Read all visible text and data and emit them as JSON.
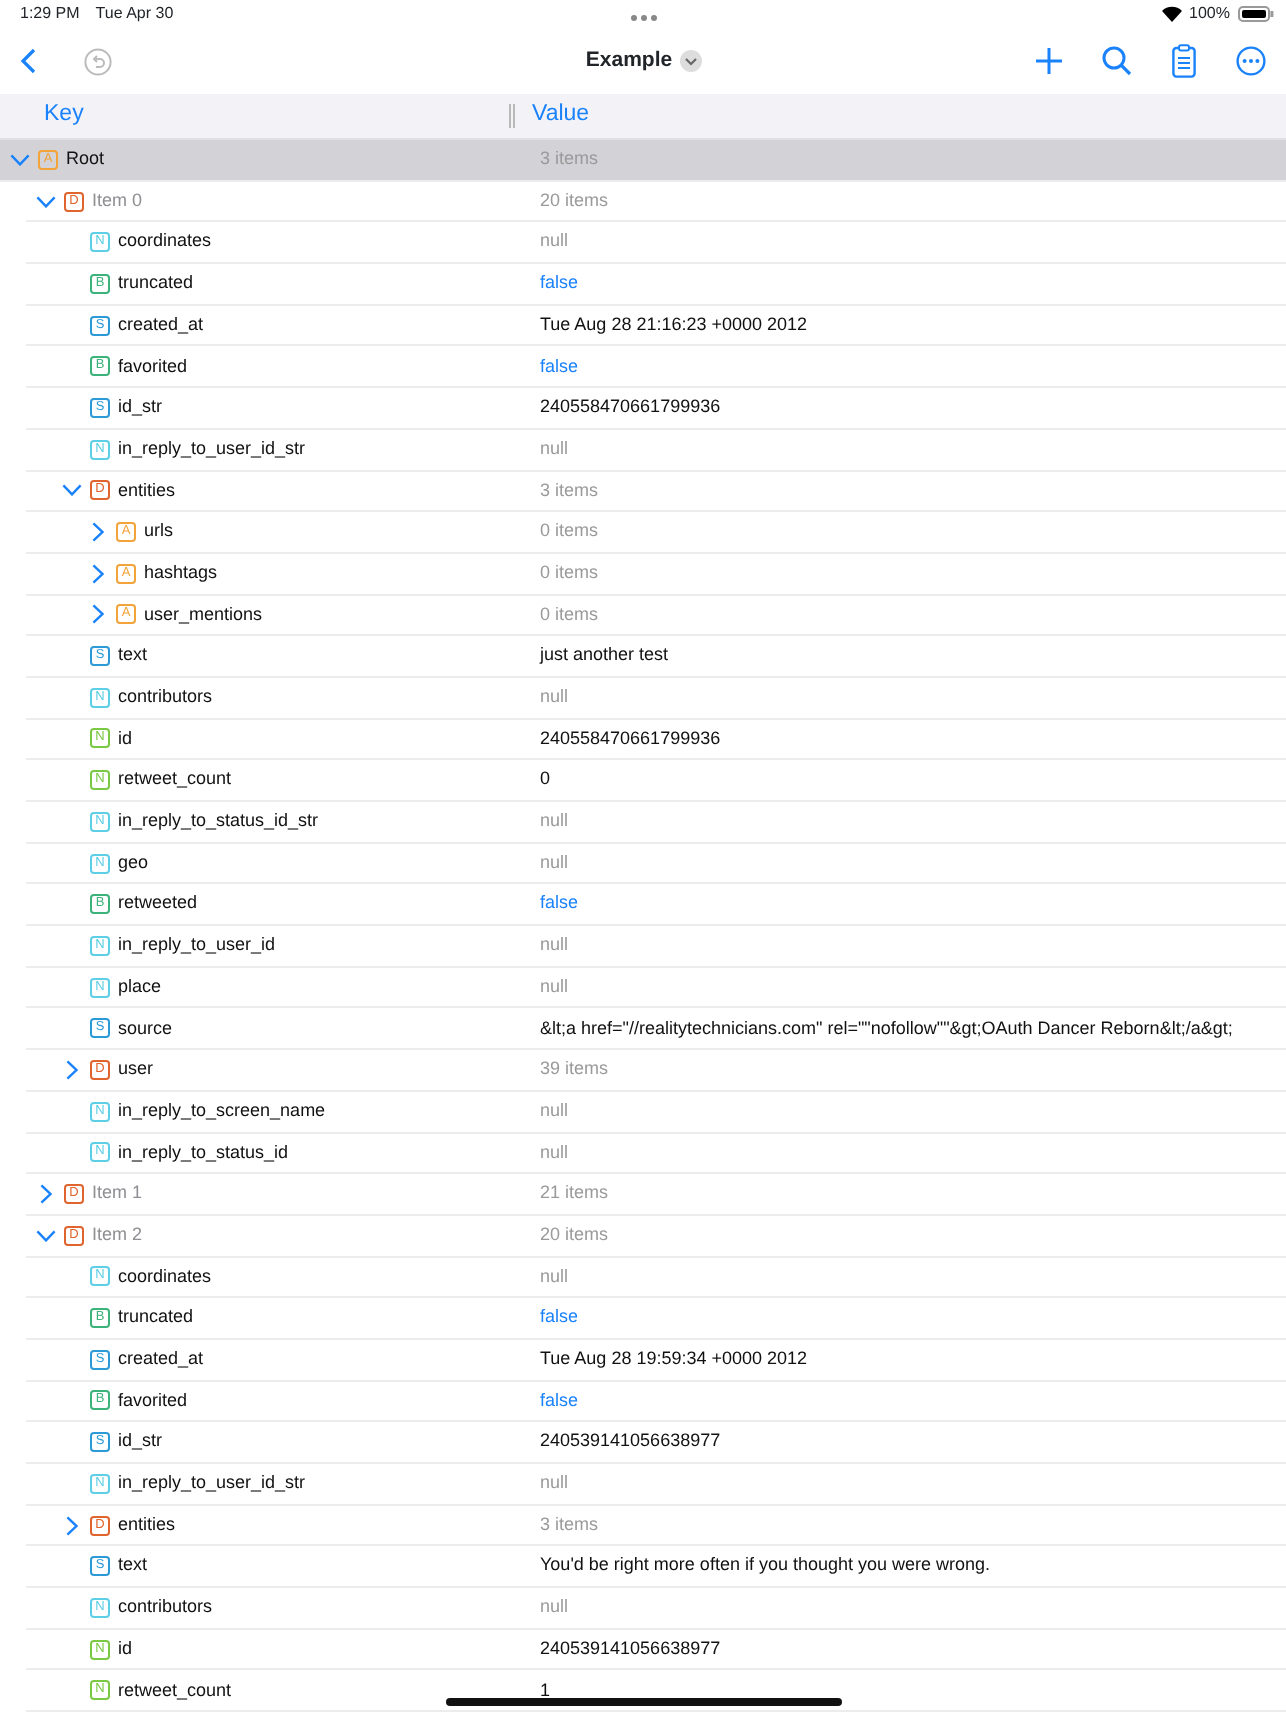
{
  "status_bar": {
    "time": "1:29 PM",
    "date": "Tue Apr 30",
    "battery": "100%"
  },
  "toolbar": {
    "title": "Example"
  },
  "columns": [
    "Key",
    "Value"
  ],
  "tree": [
    {
      "key": "Root",
      "badge": "A",
      "kind": "array",
      "value": "3 items",
      "index": false,
      "selected": true,
      "expanded": true,
      "children": [
        {
          "key": "Item 0",
          "badge": "D",
          "kind": "dict",
          "value": "20 items",
          "index": true,
          "selected": false,
          "expanded": true,
          "children": [
            {
              "key": "coordinates",
              "badge": "N",
              "kind": "null",
              "value": "null",
              "index": false,
              "selected": false
            },
            {
              "key": "truncated",
              "badge": "B",
              "kind": "bool",
              "value": "false",
              "index": false,
              "selected": false
            },
            {
              "key": "created_at",
              "badge": "S",
              "kind": "string",
              "value": "Tue Aug 28 21:16:23 +0000 2012",
              "index": false,
              "selected": false
            },
            {
              "key": "favorited",
              "badge": "B",
              "kind": "bool",
              "value": "false",
              "index": false,
              "selected": false
            },
            {
              "key": "id_str",
              "badge": "S",
              "kind": "string",
              "value": "240558470661799936",
              "index": false,
              "selected": false
            },
            {
              "key": "in_reply_to_user_id_str",
              "badge": "N",
              "kind": "null",
              "value": "null",
              "index": false,
              "selected": false
            },
            {
              "key": "entities",
              "badge": "D",
              "kind": "dict",
              "value": "3 items",
              "index": false,
              "selected": false,
              "expanded": true,
              "children": [
                {
                  "key": "urls",
                  "badge": "A",
                  "kind": "array",
                  "value": "0 items",
                  "index": false,
                  "selected": false,
                  "expanded": false
                },
                {
                  "key": "hashtags",
                  "badge": "A",
                  "kind": "array",
                  "value": "0 items",
                  "index": false,
                  "selected": false,
                  "expanded": false
                },
                {
                  "key": "user_mentions",
                  "badge": "A",
                  "kind": "array",
                  "value": "0 items",
                  "index": false,
                  "selected": false,
                  "expanded": false
                }
              ]
            },
            {
              "key": "text",
              "badge": "S",
              "kind": "string",
              "value": "just another test",
              "index": false,
              "selected": false
            },
            {
              "key": "contributors",
              "badge": "N",
              "kind": "null",
              "value": "null",
              "index": false,
              "selected": false
            },
            {
              "key": "id",
              "badge": "N",
              "kind": "number",
              "value": "240558470661799936",
              "index": false,
              "selected": false
            },
            {
              "key": "retweet_count",
              "badge": "N",
              "kind": "number",
              "value": "0",
              "index": false,
              "selected": false
            },
            {
              "key": "in_reply_to_status_id_str",
              "badge": "N",
              "kind": "null",
              "value": "null",
              "index": false,
              "selected": false
            },
            {
              "key": "geo",
              "badge": "N",
              "kind": "null",
              "value": "null",
              "index": false,
              "selected": false
            },
            {
              "key": "retweeted",
              "badge": "B",
              "kind": "bool",
              "value": "false",
              "index": false,
              "selected": false
            },
            {
              "key": "in_reply_to_user_id",
              "badge": "N",
              "kind": "null",
              "value": "null",
              "index": false,
              "selected": false
            },
            {
              "key": "place",
              "badge": "N",
              "kind": "null",
              "value": "null",
              "index": false,
              "selected": false
            },
            {
              "key": "source",
              "badge": "S",
              "kind": "string",
              "value": "&lt;a href=\"//realitytechnicians.com\" rel=\"\"nofollow\"\"&gt;OAuth Dancer Reborn&lt;/a&gt;",
              "index": false,
              "selected": false
            },
            {
              "key": "user",
              "badge": "D",
              "kind": "dict",
              "value": "39 items",
              "index": false,
              "selected": false,
              "expanded": false
            },
            {
              "key": "in_reply_to_screen_name",
              "badge": "N",
              "kind": "null",
              "value": "null",
              "index": false,
              "selected": false
            },
            {
              "key": "in_reply_to_status_id",
              "badge": "N",
              "kind": "null",
              "value": "null",
              "index": false,
              "selected": false
            }
          ]
        },
        {
          "key": "Item 1",
          "badge": "D",
          "kind": "dict",
          "value": "21 items",
          "index": true,
          "selected": false,
          "expanded": false
        },
        {
          "key": "Item 2",
          "badge": "D",
          "kind": "dict",
          "value": "20 items",
          "index": true,
          "selected": false,
          "expanded": true,
          "children": [
            {
              "key": "coordinates",
              "badge": "N",
              "kind": "null",
              "value": "null",
              "index": false,
              "selected": false
            },
            {
              "key": "truncated",
              "badge": "B",
              "kind": "bool",
              "value": "false",
              "index": false,
              "selected": false
            },
            {
              "key": "created_at",
              "badge": "S",
              "kind": "string",
              "value": "Tue Aug 28 19:59:34 +0000 2012",
              "index": false,
              "selected": false
            },
            {
              "key": "favorited",
              "badge": "B",
              "kind": "bool",
              "value": "false",
              "index": false,
              "selected": false
            },
            {
              "key": "id_str",
              "badge": "S",
              "kind": "string",
              "value": "240539141056638977",
              "index": false,
              "selected": false
            },
            {
              "key": "in_reply_to_user_id_str",
              "badge": "N",
              "kind": "null",
              "value": "null",
              "index": false,
              "selected": false
            },
            {
              "key": "entities",
              "badge": "D",
              "kind": "dict",
              "value": "3 items",
              "index": false,
              "selected": false,
              "expanded": false
            },
            {
              "key": "text",
              "badge": "S",
              "kind": "string",
              "value": "You'd be right more often if you thought you were wrong.",
              "index": false,
              "selected": false
            },
            {
              "key": "contributors",
              "badge": "N",
              "kind": "null",
              "value": "null",
              "index": false,
              "selected": false
            },
            {
              "key": "id",
              "badge": "N",
              "kind": "number",
              "value": "240539141056638977",
              "index": false,
              "selected": false
            },
            {
              "key": "retweet_count",
              "badge": "N",
              "kind": "number",
              "value": "1",
              "index": false,
              "selected": false
            }
          ]
        }
      ]
    }
  ]
}
